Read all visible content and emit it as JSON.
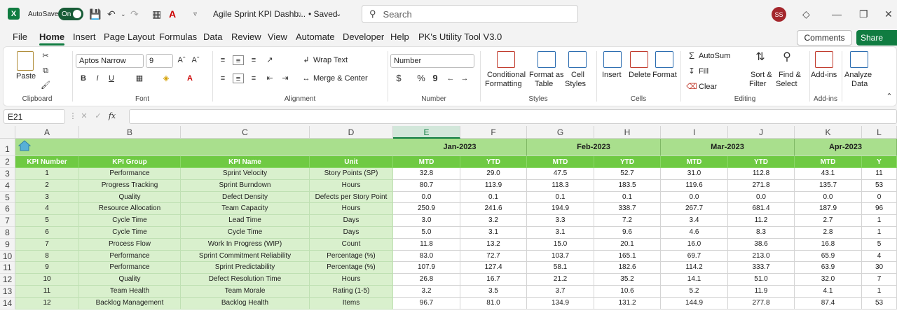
{
  "titlebar": {
    "autosave_label": "AutoSave",
    "autosave_state": "On",
    "doc_title": "Agile Sprint KPI Dashb...",
    "saved_status": "• Saved",
    "search_placeholder": "Search",
    "user_initials": "SS"
  },
  "menu": {
    "tabs": [
      "File",
      "Home",
      "Insert",
      "Page Layout",
      "Formulas",
      "Data",
      "Review",
      "View",
      "Automate",
      "Developer",
      "Help",
      "PK's Utility Tool V3.0"
    ],
    "active": "Home",
    "comments_label": "Comments",
    "share_label": "Share"
  },
  "ribbon": {
    "clipboard": {
      "label": "Clipboard",
      "paste": "Paste"
    },
    "font": {
      "label": "Font",
      "family": "Aptos Narrow",
      "size": "9",
      "bold": "B",
      "italic": "I",
      "underline": "U"
    },
    "alignment": {
      "label": "Alignment",
      "wrap": "Wrap Text",
      "merge": "Merge & Center"
    },
    "number": {
      "label": "Number",
      "format": "Number",
      "currency": "$",
      "percent": "%",
      "comma": "9"
    },
    "styles": {
      "label": "Styles",
      "cond1": "Conditional",
      "cond2": "Formatting",
      "fmt1": "Format as",
      "fmt2": "Table",
      "cell1": "Cell",
      "cell2": "Styles"
    },
    "cells": {
      "label": "Cells",
      "insert": "Insert",
      "delete": "Delete",
      "format": "Format"
    },
    "editing": {
      "label": "Editing",
      "autosum": "AutoSum",
      "fill": "Fill",
      "clear": "Clear",
      "sort1": "Sort &",
      "sort2": "Filter",
      "find1": "Find &",
      "find2": "Select"
    },
    "addins": {
      "label": "Add-ins",
      "addins": "Add-ins"
    },
    "analyze": {
      "analyze1": "Analyze",
      "analyze2": "Data"
    }
  },
  "formula_bar": {
    "name_box": "E21",
    "fx": "fx",
    "formula": ""
  },
  "sheet": {
    "col_letters": [
      "A",
      "B",
      "C",
      "D",
      "E",
      "F",
      "G",
      "H",
      "I",
      "J",
      "K",
      "L"
    ],
    "selected_col": "E",
    "row_numbers": [
      "1",
      "2",
      "3",
      "4",
      "5",
      "6",
      "7",
      "8",
      "9",
      "10",
      "11",
      "12",
      "13",
      "14"
    ],
    "months": [
      "Jan-2023",
      "Feb-2023",
      "Mar-2023",
      "Apr-2023"
    ],
    "headers": [
      "KPI Number",
      "KPI Group",
      "KPI Name",
      "Unit",
      "MTD",
      "YTD",
      "MTD",
      "YTD",
      "MTD",
      "YTD",
      "MTD",
      "Y"
    ],
    "rows": [
      [
        "1",
        "Performance",
        "Sprint Velocity",
        "Story Points (SP)",
        "32.8",
        "29.0",
        "47.5",
        "52.7",
        "31.0",
        "112.8",
        "43.1",
        "11"
      ],
      [
        "2",
        "Progress Tracking",
        "Sprint Burndown",
        "Hours",
        "80.7",
        "113.9",
        "118.3",
        "183.5",
        "119.6",
        "271.8",
        "135.7",
        "53"
      ],
      [
        "3",
        "Quality",
        "Defect Density",
        "Defects per Story Point",
        "0.0",
        "0.1",
        "0.1",
        "0.1",
        "0.0",
        "0.0",
        "0.0",
        "0"
      ],
      [
        "4",
        "Resource Allocation",
        "Team Capacity",
        "Hours",
        "250.9",
        "241.6",
        "194.9",
        "338.7",
        "267.7",
        "681.4",
        "187.9",
        "96"
      ],
      [
        "5",
        "Cycle Time",
        "Lead Time",
        "Days",
        "3.0",
        "3.2",
        "3.3",
        "7.2",
        "3.4",
        "11.2",
        "2.7",
        "1"
      ],
      [
        "6",
        "Cycle Time",
        "Cycle Time",
        "Days",
        "5.0",
        "3.1",
        "3.1",
        "9.6",
        "4.6",
        "8.3",
        "2.8",
        "1"
      ],
      [
        "7",
        "Process Flow",
        "Work In Progress (WIP)",
        "Count",
        "11.8",
        "13.2",
        "15.0",
        "20.1",
        "16.0",
        "38.6",
        "16.8",
        "5"
      ],
      [
        "8",
        "Performance",
        "Sprint Commitment Reliability",
        "Percentage (%)",
        "83.0",
        "72.7",
        "103.7",
        "165.1",
        "69.7",
        "213.0",
        "65.9",
        "4"
      ],
      [
        "9",
        "Performance",
        "Sprint Predictability",
        "Percentage (%)",
        "107.9",
        "127.4",
        "58.1",
        "182.6",
        "114.2",
        "333.7",
        "63.9",
        "30"
      ],
      [
        "10",
        "Quality",
        "Defect Resolution Time",
        "Hours",
        "26.8",
        "16.7",
        "21.2",
        "35.2",
        "14.1",
        "51.0",
        "32.0",
        "7"
      ],
      [
        "11",
        "Team Health",
        "Team Morale",
        "Rating (1-5)",
        "3.2",
        "3.5",
        "3.7",
        "10.6",
        "5.2",
        "11.9",
        "4.1",
        "1"
      ],
      [
        "12",
        "Backlog Management",
        "Backlog Health",
        "Items",
        "96.7",
        "81.0",
        "134.9",
        "131.2",
        "144.9",
        "277.8",
        "87.4",
        "53"
      ]
    ]
  }
}
